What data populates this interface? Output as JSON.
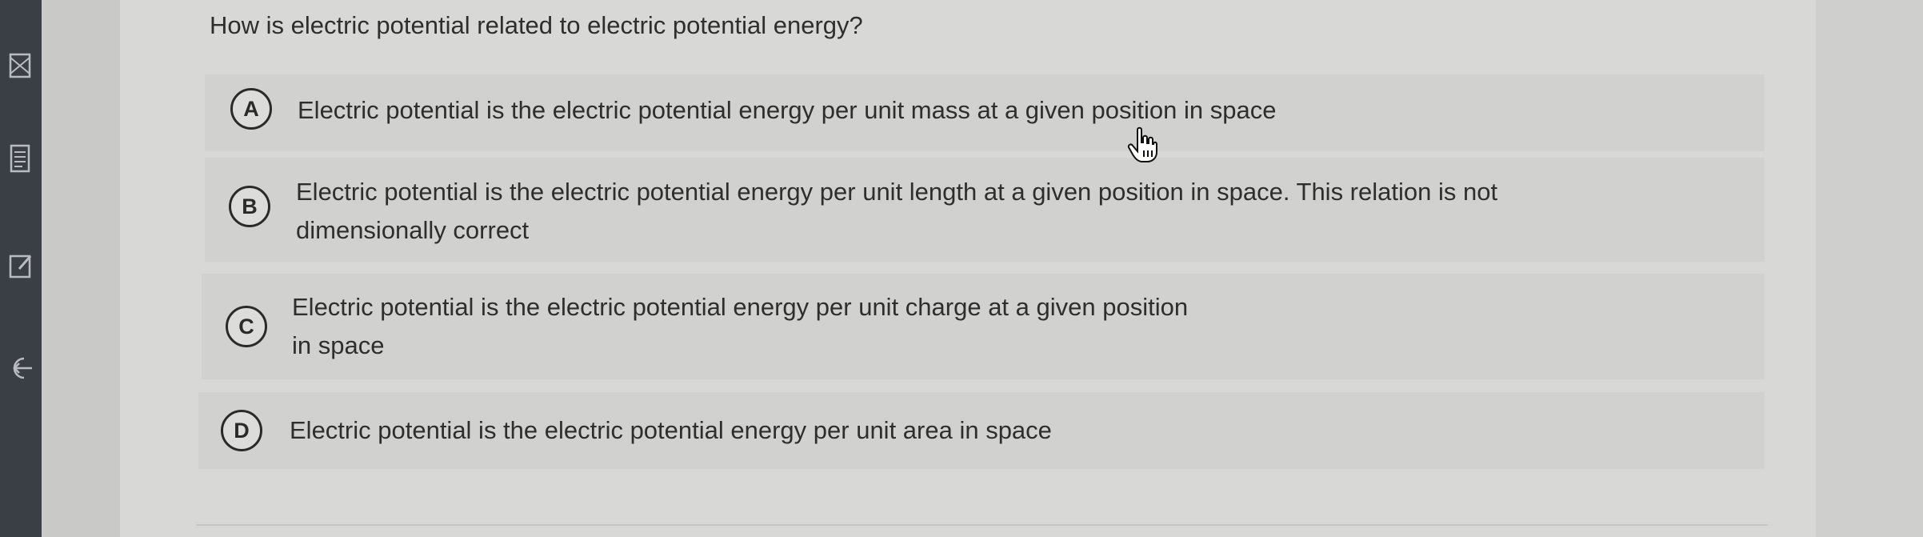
{
  "question": {
    "text": "How is electric potential related to electric potential energy?"
  },
  "options": [
    {
      "letter": "A",
      "line1": "Electric potential is the electric potential energy per unit mass at a given position in space",
      "line2": ""
    },
    {
      "letter": "B",
      "line1": "Electric potential is the electric potential energy per unit length at a given position in space. This relation is not",
      "line2": "dimensionally correct"
    },
    {
      "letter": "C",
      "line1": "Electric potential is the electric potential energy per unit charge at a given position",
      "line2": "in space"
    },
    {
      "letter": "D",
      "line1": "Electric potential is the electric potential energy per unit area in space",
      "line2": ""
    }
  ],
  "sidebar": {
    "icons": [
      "mail-icon",
      "notes-icon",
      "edit-icon",
      "exit-icon"
    ]
  },
  "colors": {
    "sidebar_bg": "#3a3f46",
    "page_bg": "#d8d8d6",
    "option_bg": "#d1d1cf",
    "text": "#2e2e2e"
  }
}
